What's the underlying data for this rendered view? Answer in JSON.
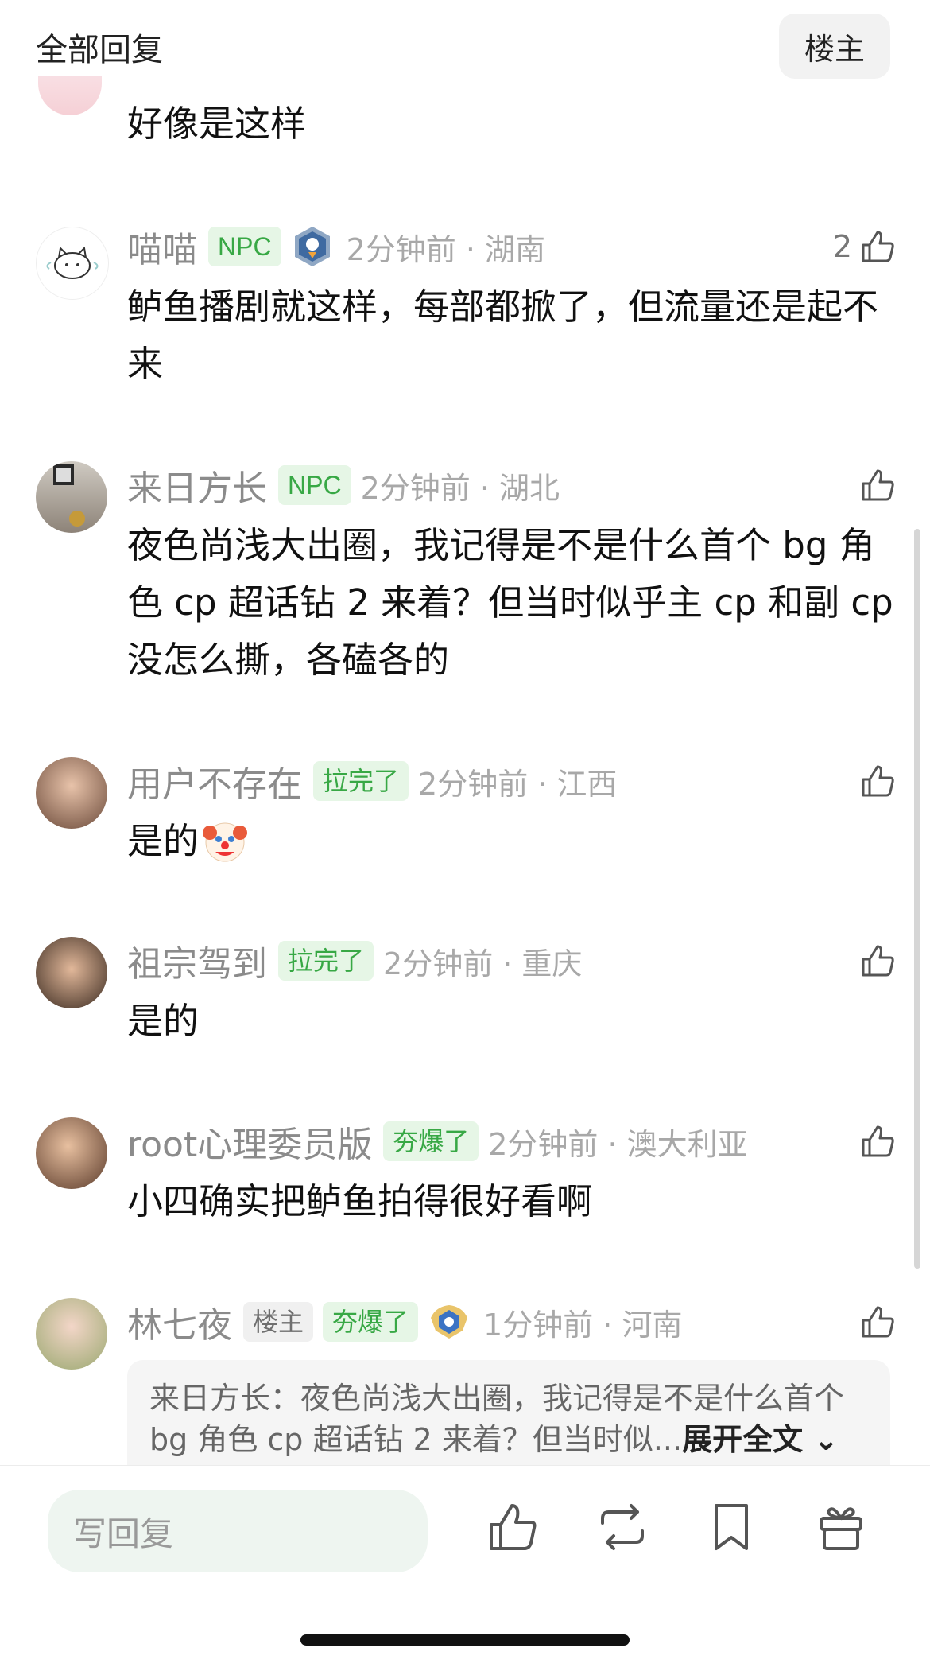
{
  "header": {
    "title": "全部回复",
    "owner_button": "楼主"
  },
  "top_comment": {
    "text": "好像是这样"
  },
  "comments": [
    {
      "name": "喵喵",
      "tags": [
        "NPC"
      ],
      "time": "2分钟前 · 湖南",
      "likes": "2",
      "text": "鲈鱼播剧就这样，每部都掀了，但流量还是起不来"
    },
    {
      "name": "来日方长",
      "tags": [
        "NPC"
      ],
      "time": "2分钟前 · 湖北",
      "likes": "",
      "text": "夜色尚浅大出圈，我记得是不是什么首个 bg 角色 cp 超话钻 2 来着？但当时似乎主 cp 和副 cp 没怎么撕，各磕各的"
    },
    {
      "name": "用户不存在",
      "tags": [
        "拉完了"
      ],
      "time": "2分钟前 · 江西",
      "likes": "",
      "text": "是的"
    },
    {
      "name": "祖宗驾到",
      "tags": [
        "拉完了"
      ],
      "time": "2分钟前 · 重庆",
      "likes": "",
      "text": "是的"
    },
    {
      "name": "root心理委员版",
      "tags": [
        "夯爆了"
      ],
      "time": "2分钟前 · 澳大利亚",
      "likes": "",
      "text": "小四确实把鲈鱼拍得很好看啊"
    },
    {
      "name": "林七夜",
      "tags": [
        "楼主",
        "夯爆了"
      ],
      "time": "1分钟前 · 河南",
      "likes": "",
      "text": ""
    }
  ],
  "quote": {
    "text": "来日方长：夜色尚浅大出圈，我记得是不是什么首个 bg 角色 cp 超话钻 2 来着？但当时似...",
    "expand": "展开全文"
  },
  "bottom_bar": {
    "reply_placeholder": "写回复"
  },
  "colors": {
    "tag_green_bg": "#e6f6e6",
    "tag_green_text": "#38a845",
    "meta_gray": "#a8a8a8"
  }
}
